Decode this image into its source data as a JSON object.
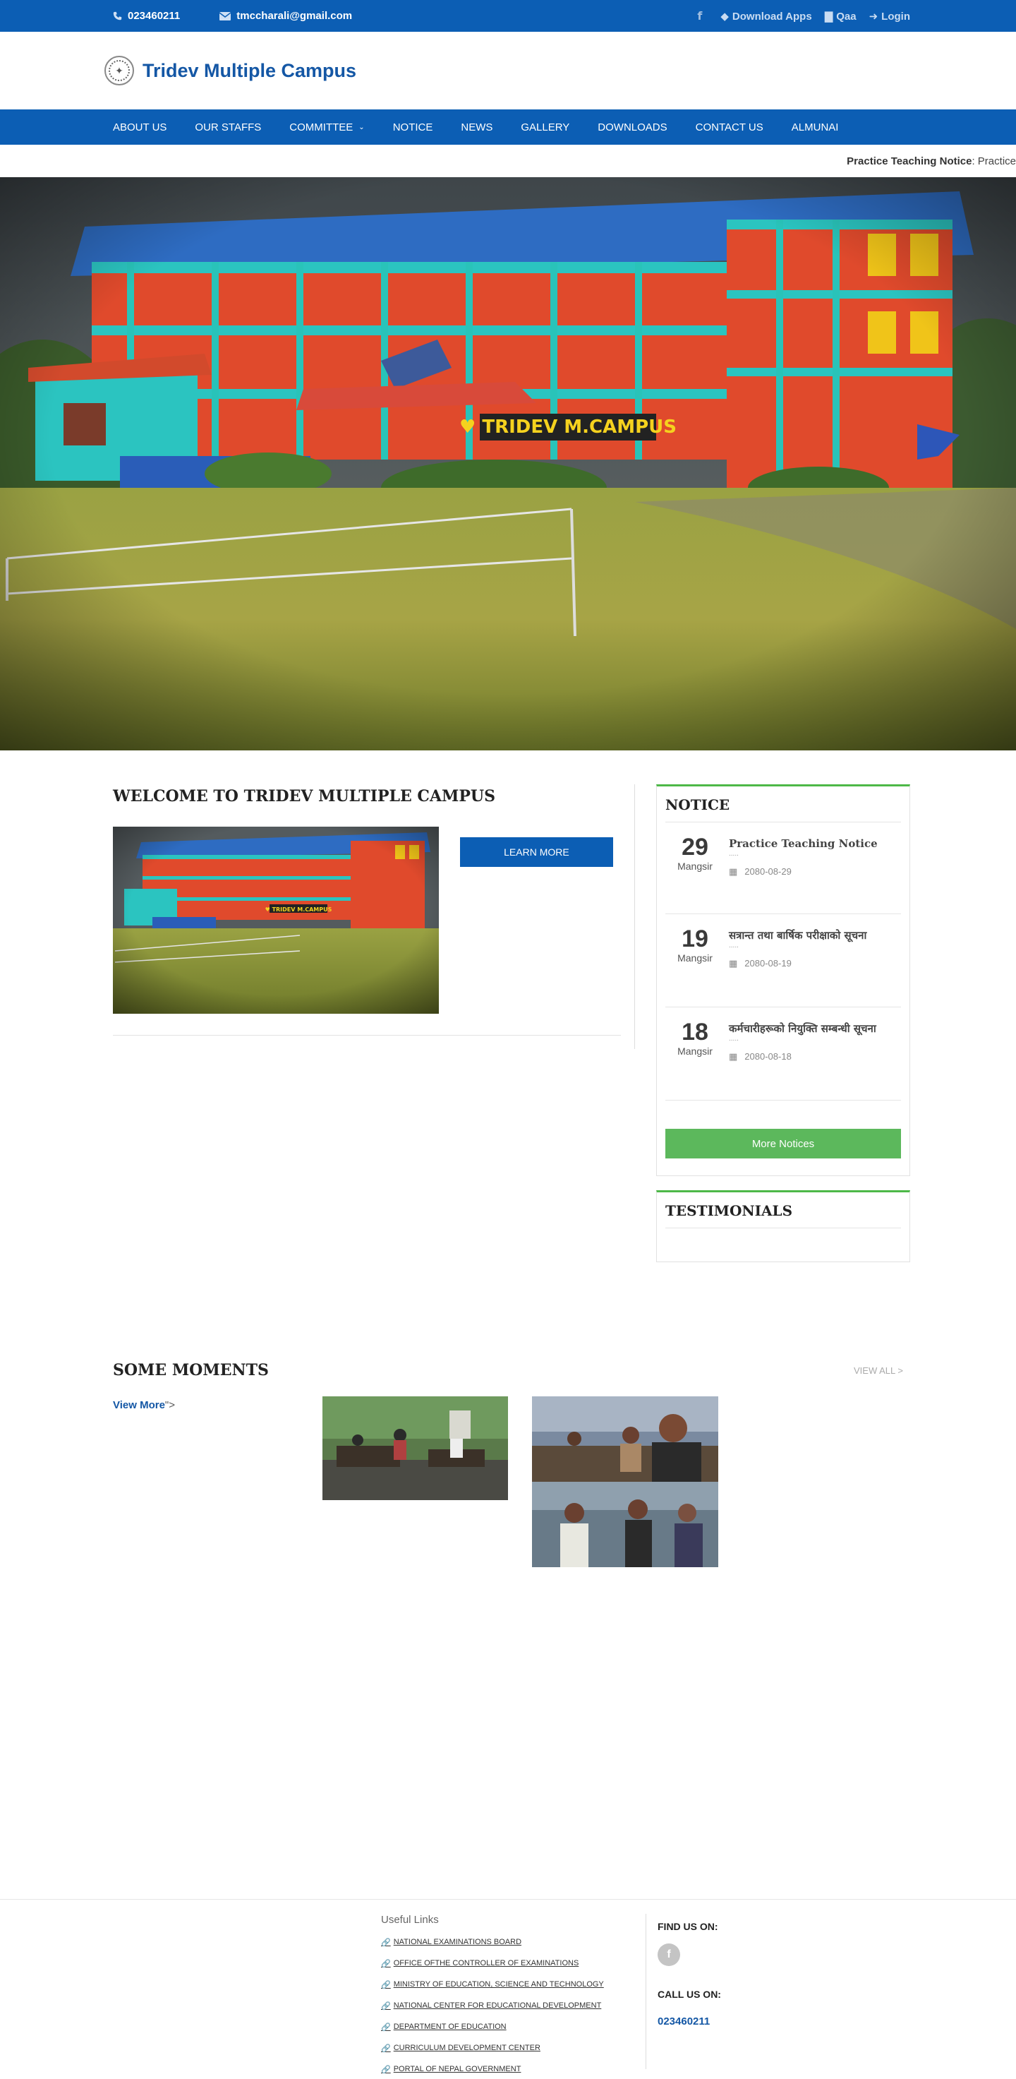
{
  "topbar": {
    "phone": "023460211",
    "email": "tmccharali@gmail.com",
    "facebook_icon": "facebook-icon",
    "download_apps": "Download Apps",
    "qaa": "Qaa",
    "login": "Login"
  },
  "header": {
    "site_title": "Tridev Multiple Campus"
  },
  "nav": {
    "items": [
      {
        "label": "ABOUT US"
      },
      {
        "label": "OUR STAFFS"
      },
      {
        "label": "COMMITTEE",
        "has_dropdown": true
      },
      {
        "label": "NOTICE"
      },
      {
        "label": "NEWS"
      },
      {
        "label": "GALLERY"
      },
      {
        "label": "DOWNLOADS"
      },
      {
        "label": "CONTACT US"
      },
      {
        "label": "ALMUNAI"
      }
    ]
  },
  "ticker": {
    "title": "Practice Teaching Notice",
    "rest": " : Practice"
  },
  "hero": {
    "sign_text": "TRIDEV M.CAMPUS"
  },
  "welcome": {
    "title": "WELCOME TO TRIDEV MULTIPLE CAMPUS",
    "button": "LEARN MORE"
  },
  "notice_widget": {
    "title": "NOTICE",
    "items": [
      {
        "day": "29",
        "month": "Mangsir",
        "title": "Practice Teaching Notice",
        "dots": ".....",
        "date": "2080-08-29"
      },
      {
        "day": "19",
        "month": "Mangsir",
        "title": "सत्रान्त तथा बार्षिक परीक्षाको सूचना",
        "dots": ".....",
        "date": "2080-08-19"
      },
      {
        "day": "18",
        "month": "Mangsir",
        "title": "कर्मचारीहरूको नियुक्ति सम्बन्धी सूचना",
        "dots": ".....",
        "date": "2080-08-18"
      }
    ],
    "more_button": "More Notices"
  },
  "testimonials": {
    "title": "TESTIMONIALS"
  },
  "moments": {
    "title": "SOME MOMENTS",
    "view_all": "VIEW ALL >",
    "view_more": "View More",
    "view_more_suffix": "\">"
  },
  "footer": {
    "useful_links_title": "Useful Links",
    "links": [
      "NATIONAL EXAMINATIONS BOARD",
      "OFFICE OFTHE CONTROLLER OF EXAMINATIONS",
      "MINISTRY OF EDUCATION, SCIENCE AND TECHNOLOGY",
      "NATIONAL CENTER FOR EDUCATIONAL DEVELOPMENT",
      "DEPARTMENT OF EDUCATION",
      "CURRICULUM DEVELOPMENT CENTER",
      "PORTAL OF NEPAL GOVERNMENT"
    ],
    "find_us": "FIND US ON:",
    "facebook_letter": "f",
    "call_us": "CALL US ON:",
    "phone": "023460211"
  },
  "colors": {
    "primary": "#0c5eb4",
    "green": "#5cb85c",
    "widget_accent": "#4db848"
  }
}
